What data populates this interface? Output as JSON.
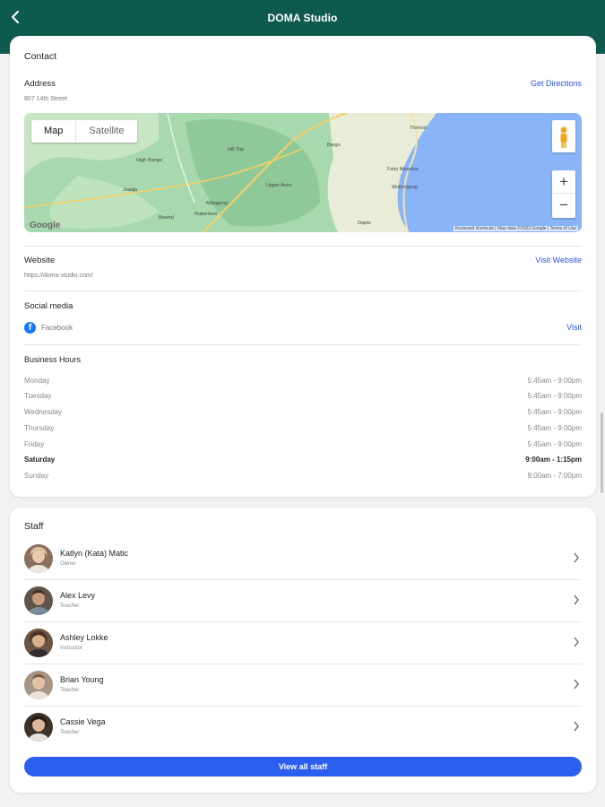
{
  "header": {
    "title": "DOMA Studio",
    "back_icon": "chevron-left-icon"
  },
  "contact": {
    "title": "Contact",
    "address": {
      "label": "Address",
      "value": "807 14th Street",
      "action": "Get Directions"
    },
    "map": {
      "map_tab": "Map",
      "satellite_tab": "Satellite",
      "zoom_in": "+",
      "zoom_out": "−",
      "logo": "Google",
      "attribution": "Keyboard shortcuts | Map data ©2023 Google | Terms of Use",
      "labels": [
        "High Range",
        "Joadja",
        "Hill Top",
        "Upper Avon",
        "Bargo",
        "Thirroul",
        "Fairy Meadow",
        "Wollongong",
        "Mittagong",
        "Bowral",
        "Robertson",
        "Dapto"
      ]
    },
    "website": {
      "label": "Website",
      "value": "https://doma-studio.com/",
      "action": "Visit Website"
    },
    "social": {
      "label": "Social media",
      "platform": "Facebook",
      "action": "Visit",
      "icon": "facebook-icon"
    },
    "hours": {
      "label": "Business Hours",
      "rows": [
        {
          "day": "Monday",
          "time": "5:45am - 9:00pm"
        },
        {
          "day": "Tuesday",
          "time": "5:45am - 9:00pm"
        },
        {
          "day": "Wednesday",
          "time": "5:45am - 9:00pm"
        },
        {
          "day": "Thursday",
          "time": "5:45am - 9:00pm"
        },
        {
          "day": "Friday",
          "time": "5:45am - 9:00pm"
        },
        {
          "day": "Saturday",
          "time": "9:00am - 1:15pm"
        },
        {
          "day": "Sunday",
          "time": "9:00am - 7:00pm"
        }
      ]
    }
  },
  "staff": {
    "title": "Staff",
    "members": [
      {
        "name": "Katlyn (Kata) Matic",
        "role": "Owner"
      },
      {
        "name": "Alex Levy",
        "role": "Teacher"
      },
      {
        "name": "Ashley Lokke",
        "role": "Instructor"
      },
      {
        "name": "Brian Young",
        "role": "Teacher"
      },
      {
        "name": "Cassie Vega",
        "role": "Teacher"
      }
    ],
    "view_all": "View all staff"
  },
  "colors": {
    "header_bg": "#0f5a4f",
    "link": "#2b55d9",
    "button": "#2b5ff0",
    "facebook": "#1877f2"
  }
}
